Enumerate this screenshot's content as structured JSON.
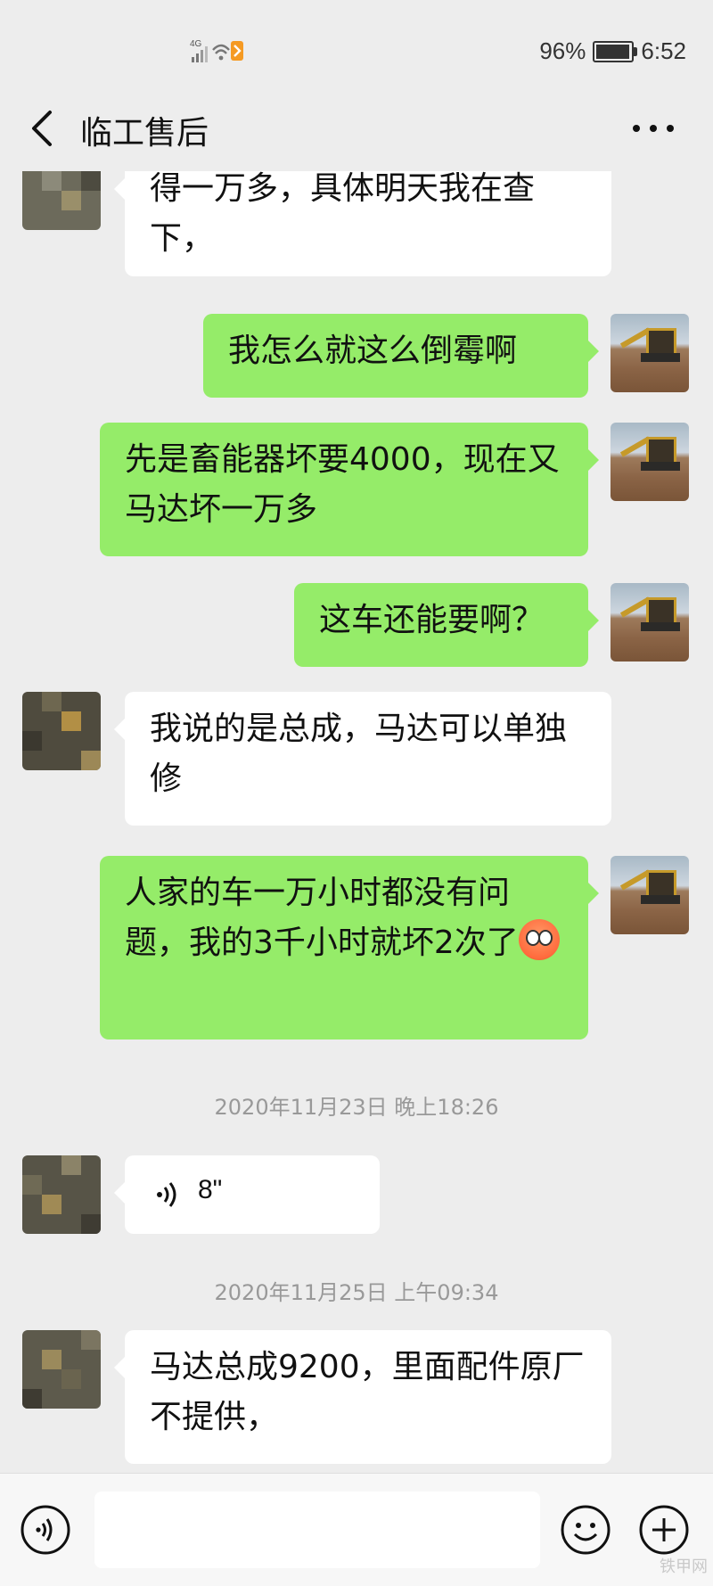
{
  "status": {
    "network": "4G",
    "battery_percent": "96%",
    "battery_level": 0.96,
    "time": "6:52"
  },
  "header": {
    "title": "临工售后"
  },
  "messages": [
    {
      "side": "left",
      "text": "得一万多，具体明天我在查下，",
      "avatar": "contact"
    },
    {
      "side": "right",
      "text": "我怎么就这么倒霉啊",
      "avatar": "me"
    },
    {
      "side": "right",
      "text": "先是畜能器坏要4000，现在又马达坏一万多",
      "avatar": "me"
    },
    {
      "side": "right",
      "text": "这车还能要啊？",
      "avatar": "me"
    },
    {
      "side": "left",
      "text": "我说的是总成，马达可以单独修",
      "avatar": "contact"
    },
    {
      "side": "right",
      "text": "人家的车一万小时都没有问题，我的3千小时就坏2次了",
      "emoji": "flushed-face",
      "avatar": "me"
    }
  ],
  "timestamps": [
    "2020年11月23日 晚上18:26",
    "2020年11月25日 上午09:34"
  ],
  "voice_message": {
    "duration": "8\""
  },
  "last_message": {
    "side": "left",
    "text": "马达总成9200，里面配件原厂不提供，",
    "avatar": "contact"
  },
  "colors": {
    "background": "#ededed",
    "self_bubble": "#95ec69",
    "other_bubble": "#ffffff"
  },
  "watermark": "铁甲网"
}
